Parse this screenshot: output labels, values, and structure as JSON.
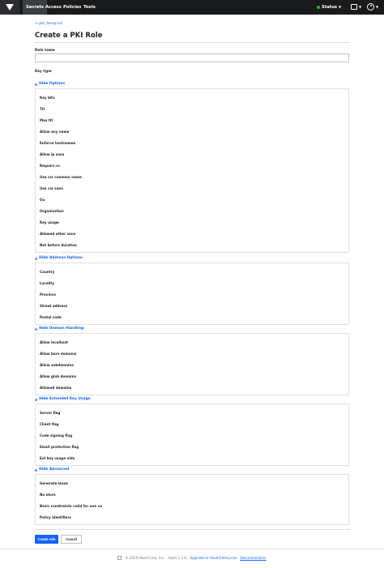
{
  "nav": {
    "items": [
      {
        "label": "Secrets",
        "active": true
      },
      {
        "label": "Access",
        "active": false
      },
      {
        "label": "Policies",
        "active": false
      },
      {
        "label": "Tools",
        "active": false
      }
    ],
    "status_label": "Status",
    "status_color": "#2eb039"
  },
  "breadcrumb": "< pki_temp-int",
  "page_title": "Create a PKI Role",
  "fields": {
    "role_name_label": "Role name",
    "role_name_value": "",
    "key_type_label": "Key type"
  },
  "sections": {
    "options": {
      "toggle": "Hide Options",
      "rows": [
        "Key bits",
        "Ttl",
        "Max ttl",
        "Allow any name",
        "Enforce hostnames",
        "Allow ip sans",
        "Require cn",
        "Use csr common name",
        "Use csr sans",
        "Ou",
        "Organization",
        "Key usage",
        "Allowed other sans",
        "Not before duration"
      ]
    },
    "address": {
      "toggle": "Hide Address Options",
      "rows": [
        "Country",
        "Locality",
        "Province",
        "Street address",
        "Postal code"
      ]
    },
    "domain": {
      "toggle": "Hide Domain Handling",
      "rows": [
        "Allow localhost",
        "Allow bare domains",
        "Allow subdomains",
        "Allow glob domains",
        "Allowed domains"
      ]
    },
    "eku": {
      "toggle": "Hide Extended Key Usage",
      "rows": [
        "Server flag",
        "Client flag",
        "Code signing flag",
        "Email protection flag",
        "Ext key usage oids"
      ]
    },
    "advanced": {
      "toggle": "Hide Advanced",
      "rows": [
        "Generate lease",
        "No store",
        "Basic constraints valid for non ca",
        "Policy identifiers"
      ]
    }
  },
  "buttons": {
    "create": "Create role",
    "cancel": "Cancel"
  },
  "footer": {
    "copyright": "© 2019 HashiCorp, Inc.",
    "version": "Vault 1.1.0",
    "upgrade": "Upgrade to Vault Enterprise",
    "docs": "Documentation"
  },
  "colors": {
    "accent": "#1563ff",
    "topbar": "#191a1c"
  },
  "icons": {
    "logo": "vault-logo-icon",
    "console": "console-icon",
    "user": "user-icon"
  }
}
